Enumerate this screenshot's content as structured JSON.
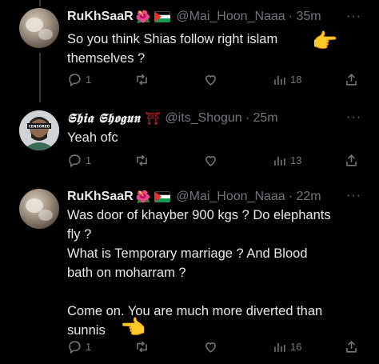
{
  "tweets": [
    {
      "display_name": "RuKhSaaR",
      "name_emoji": "🌺",
      "flag": "palestine",
      "handle": "@Mai_Hoon_Naaa",
      "time": "· 35m",
      "more": "···",
      "text": "So you think Shias follow right islam\nthemselves ?",
      "text_emoji": "👉",
      "replies": "1",
      "retweets": "",
      "likes": "",
      "views": "18"
    },
    {
      "display_name": "𝕾𝖍𝖎𝖆 𝕾𝖍𝖔𝖌𝖚𝖓",
      "name_emoji": "⛩",
      "handle": "@its_Shogun",
      "time": "· 25m",
      "more": "···",
      "avatar_badge": "CENSORED",
      "text": "Yeah ofc",
      "replies": "1",
      "retweets": "",
      "likes": "",
      "views": "13"
    },
    {
      "display_name": "RuKhSaaR",
      "name_emoji": "🌺",
      "flag": "palestine",
      "handle": "@Mai_Hoon_Naaa",
      "time": "· 22m",
      "more": "···",
      "text": "Was door of khayber 900 kgs ? Do elephants\nfly ?\nWhat is Temporary marriage ? And Blood\nbath on moharram ?\n\nCome on. You are much more diverted than\nsunnis",
      "text_emoji": "👈",
      "replies": "1",
      "retweets": "",
      "likes": "",
      "views": "16"
    }
  ],
  "colors": {
    "background": "#000000",
    "text": "#e7e9ea",
    "muted": "#71767b",
    "thread_line": "#333639",
    "torii": "#f4212e"
  },
  "icons": [
    "reply-icon",
    "retweet-icon",
    "like-icon",
    "views-icon",
    "share-icon",
    "more-icon"
  ]
}
